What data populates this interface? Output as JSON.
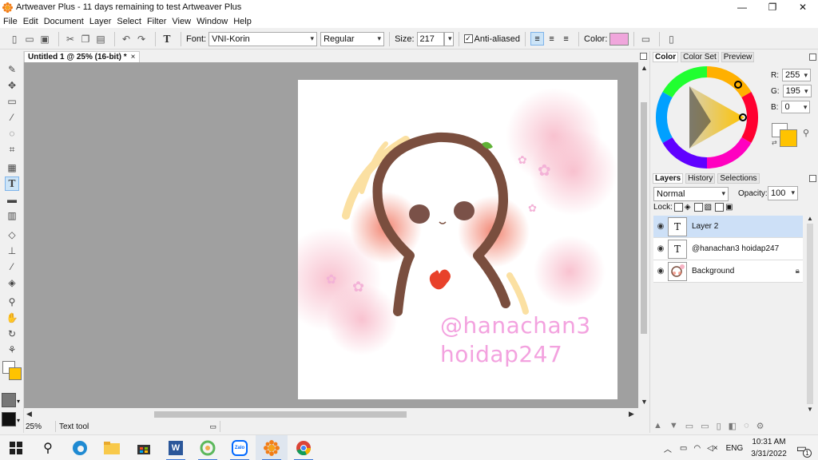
{
  "window": {
    "title": "Artweaver Plus - 11 days remaining to test Artweaver Plus",
    "minimize_icon": "minimize-icon",
    "maximize_icon": "restore-icon",
    "close_icon": "close-icon"
  },
  "menu": [
    "File",
    "Edit",
    "Document",
    "Layer",
    "Select",
    "Filter",
    "View",
    "Window",
    "Help"
  ],
  "toolbar": {
    "font_label": "Font:",
    "font_value": "VNI-Korin",
    "style_value": "Regular",
    "size_label": "Size:",
    "size_value": "217",
    "antialias_label": "Anti-aliased",
    "antialias_checked": true,
    "color_label": "Color:",
    "color_value": "#f0a6dc",
    "alignment_selected": "left"
  },
  "document": {
    "tab_title": "Untitled 1 @ 25% (16-bit) *",
    "tab_close": "×",
    "canvas_text_line1": "@hanachan3",
    "canvas_text_line2": "hoidap247",
    "text_color": "#f3a2df"
  },
  "status": {
    "zoom": "25%",
    "tool": "Text tool"
  },
  "color_panel": {
    "tabs": [
      "Color",
      "Color Set",
      "Preview"
    ],
    "active_tab": "Color",
    "r_label": "R:",
    "r_value": "255",
    "g_label": "G:",
    "g_value": "195",
    "b_label": "B:",
    "b_value": "0",
    "foreground": "#ffc300",
    "background": "#ffffff"
  },
  "layers_panel": {
    "tabs": [
      "Layers",
      "History",
      "Selections"
    ],
    "active_tab": "Layers",
    "blend_mode": "Normal",
    "opacity_label": "Opacity:",
    "opacity_value": "100",
    "lock_label": "Lock:",
    "layers": [
      {
        "name": "Layer 2",
        "type": "text",
        "thumb": "T",
        "selected": true,
        "locked": false
      },
      {
        "name": "@hanachan3 hoidap247",
        "type": "text",
        "thumb": "T",
        "selected": false,
        "locked": false
      },
      {
        "name": "Background",
        "type": "image",
        "thumb": "",
        "selected": false,
        "locked": true
      }
    ]
  },
  "taskbar": {
    "apps": [
      "windows-start-icon",
      "search-icon",
      "edge-icon",
      "file-explorer-icon",
      "store-icon",
      "word-icon",
      "app-green-icon",
      "zalo-icon",
      "artweaver-icon",
      "chrome-icon"
    ],
    "zalo_label": "Zalo",
    "word_label": "W",
    "language": "ENG",
    "time": "10:31 AM",
    "date": "3/31/2022",
    "notification_count": "1"
  }
}
